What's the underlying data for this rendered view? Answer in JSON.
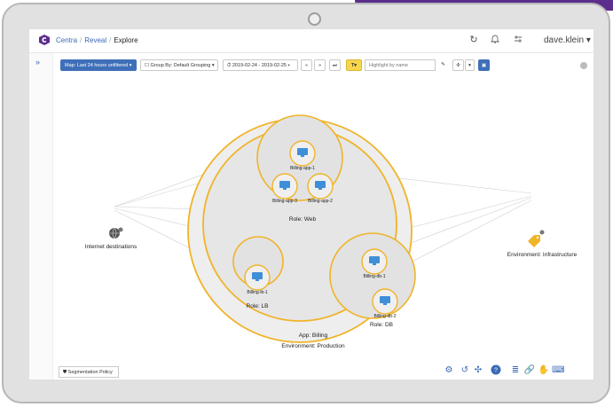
{
  "header": {
    "breadcrumb": [
      "Centra",
      "Reveal",
      "Explore"
    ],
    "user": "dave.klein",
    "user_caret": "▾"
  },
  "toolbar": {
    "map_button": "Map: Last 24 hours unfiltered",
    "group_by": "Group By: Default Grouping",
    "date_range": "2019-02-24 - 2019-02-25",
    "search_placeholder": "Highlight by name"
  },
  "graph": {
    "internet_label": "Internet destinations",
    "infrastructure_label": "Environment: Infrastructure",
    "environment_label": "Environment: Production",
    "app_label": "App: Billing",
    "web_label": "Role: Web",
    "lb_label": "Role: LB",
    "db_label": "Role: DB",
    "nodes": {
      "app1": "Billing-app-1",
      "app2": "Billing-app-2",
      "app3": "Billing-app-3",
      "lb1": "Billing-lb-1",
      "db1": "Billing-db-1",
      "db2": "Billing-db-2"
    }
  },
  "footer": {
    "segmentation_policy": "Segmentation Policy"
  },
  "colors": {
    "accent_orange": "#f0b429",
    "brand_blue": "#3f6fb8",
    "brand_purple": "#5b2e8c"
  }
}
